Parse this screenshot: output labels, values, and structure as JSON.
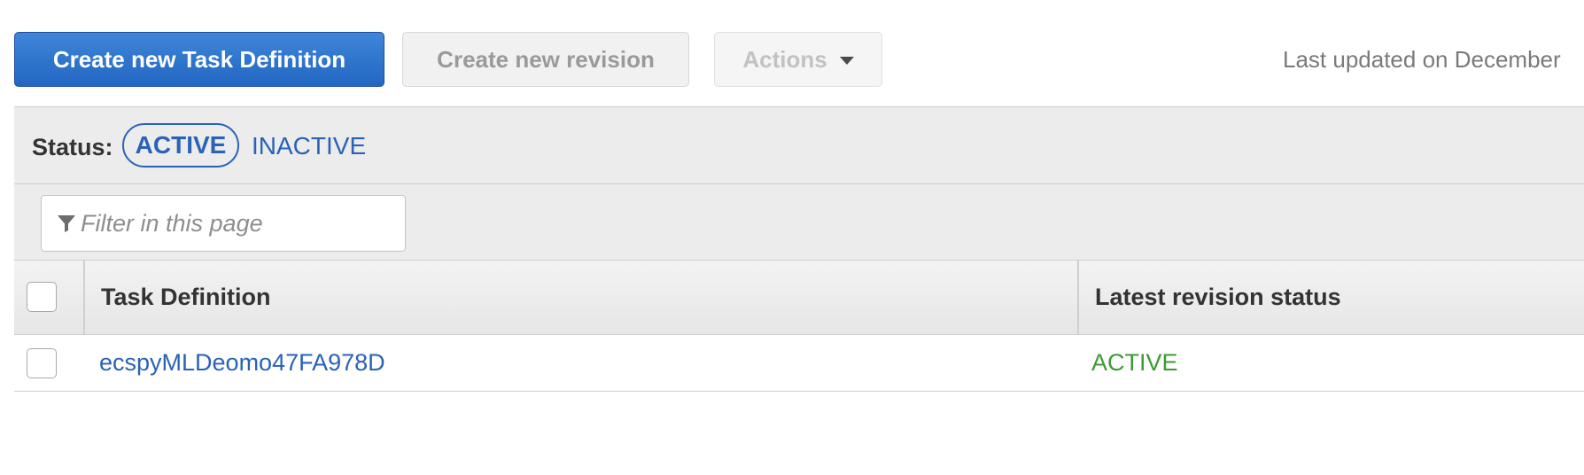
{
  "toolbar": {
    "create_task_definition_label": "Create new Task Definition",
    "create_revision_label": "Create new revision",
    "actions_label": "Actions",
    "last_updated_text": "Last updated on December"
  },
  "status_filter": {
    "label": "Status:",
    "active_label": "ACTIVE",
    "inactive_label": "INACTIVE",
    "selected": "ACTIVE"
  },
  "filter": {
    "placeholder": "Filter in this page",
    "value": ""
  },
  "table": {
    "columns": [
      "Task Definition",
      "Latest revision status"
    ],
    "rows": [
      {
        "task_definition": "ecspyMLDeomo47FA978D",
        "latest_revision_status": "ACTIVE"
      }
    ]
  },
  "icons": {
    "filter": "funnel-icon",
    "actions_dropdown": "caret-down-icon"
  },
  "colors": {
    "primary_button": "#2266c2",
    "link": "#2a62b8",
    "active_status": "#3d9a35"
  }
}
